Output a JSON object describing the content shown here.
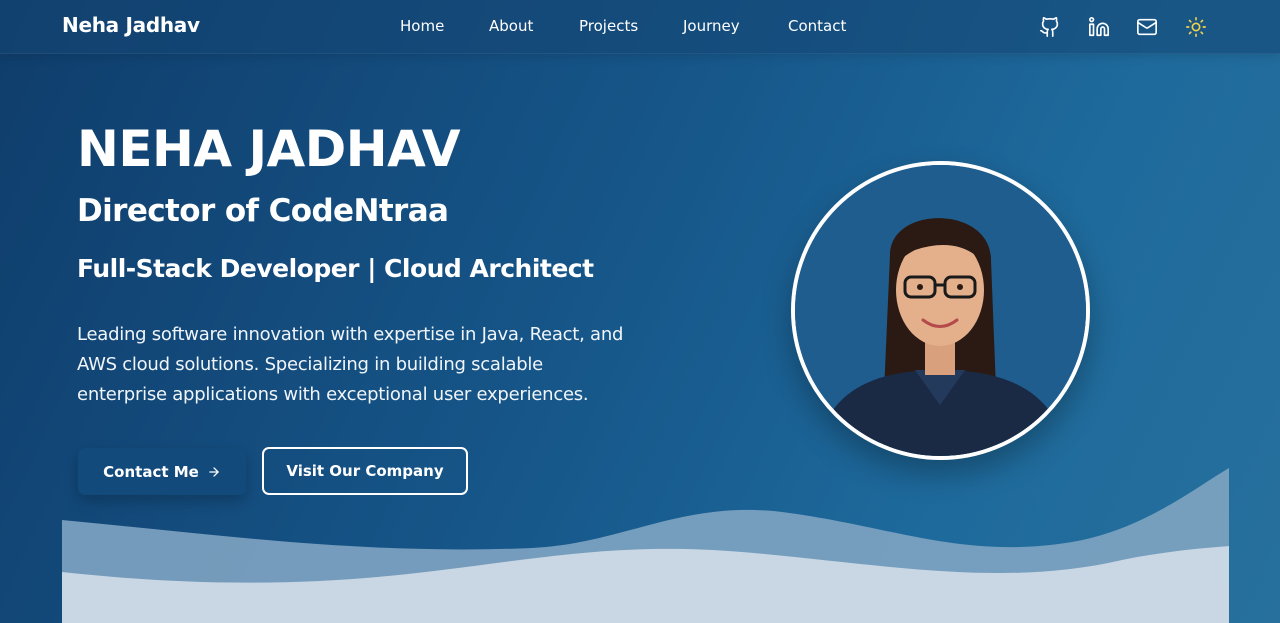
{
  "navbar": {
    "brand": "Neha Jadhav",
    "links": [
      "Home",
      "About",
      "Projects",
      "Journey",
      "Contact"
    ],
    "icons": [
      "github-icon",
      "linkedin-icon",
      "mail-icon",
      "sun-icon"
    ]
  },
  "hero": {
    "name": "NEHA JADHAV",
    "role": "Director of CodeNtraa",
    "tagline": "Full-Stack Developer | Cloud Architect",
    "description": "Leading software innovation with expertise in Java, React, and AWS cloud solutions. Specializing in building scalable enterprise applications with exceptional user experiences.",
    "primary_button": "Contact Me",
    "secondary_button": "Visit Our Company"
  },
  "colors": {
    "background_start": "#0f3d6b",
    "background_end": "#27709d",
    "accent_sun": "#f2d24a",
    "button_primary": "#134a7c"
  }
}
